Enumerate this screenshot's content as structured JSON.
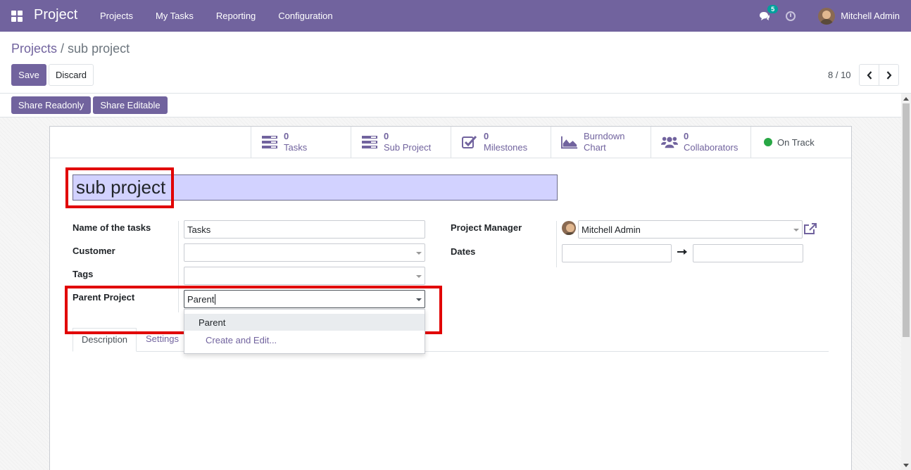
{
  "navbar": {
    "app_title": "Project",
    "menu": [
      "Projects",
      "My Tasks",
      "Reporting",
      "Configuration"
    ],
    "message_count": "5",
    "user_name": "Mitchell Admin"
  },
  "breadcrumb": {
    "parent": "Projects",
    "separator": "/",
    "current": "sub project"
  },
  "toolbar": {
    "save_label": "Save",
    "discard_label": "Discard",
    "pager": "8 / 10"
  },
  "statusbar": {
    "share_readonly": "Share Readonly",
    "share_editable": "Share Editable"
  },
  "stat_buttons": [
    {
      "value": "0",
      "label": "Tasks"
    },
    {
      "value": "0",
      "label": "Sub Project"
    },
    {
      "value": "0",
      "label": "Milestones"
    },
    {
      "label": "Burndown",
      "label2": "Chart"
    },
    {
      "value": "0",
      "label": "Collaborators"
    },
    {
      "label": "On Track"
    }
  ],
  "form": {
    "title": "sub project",
    "name_of_tasks_label": "Name of the tasks",
    "name_of_tasks_value": "Tasks",
    "customer_label": "Customer",
    "tags_label": "Tags",
    "parent_project_label": "Parent Project",
    "parent_project_value": "Parent",
    "project_manager_label": "Project Manager",
    "project_manager_value": "Mitchell Admin",
    "dates_label": "Dates"
  },
  "dropdown": {
    "options": [
      "Parent"
    ],
    "create_edit": "Create and Edit..."
  },
  "tabs": [
    "Description",
    "Settings"
  ],
  "colors": {
    "brand": "#71639e",
    "highlight": "#e10000",
    "status_ok": "#28a745",
    "badge": "#00a09d"
  }
}
